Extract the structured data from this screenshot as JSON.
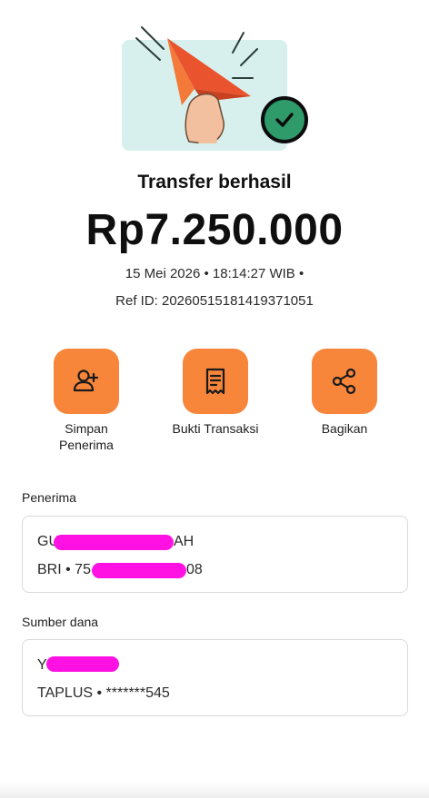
{
  "header": {
    "title": "Transfer berhasil",
    "amount": "Rp7.250.000",
    "datetime": "15 Mei 2026 • 18:14:27 WIB •",
    "ref_id": "Ref ID: 20260515181419371051"
  },
  "actions": [
    {
      "label": "Simpan Penerima",
      "icon": "add-user-icon"
    },
    {
      "label": "Bukti Transaksi",
      "icon": "receipt-icon"
    },
    {
      "label": "Bagikan",
      "icon": "share-icon"
    }
  ],
  "recipient": {
    "label": "Penerima",
    "name_prefix": "GU",
    "name_suffix": "AH",
    "account_prefix": "BRI • 75",
    "account_suffix": "08"
  },
  "source": {
    "label": "Sumber dana",
    "name_prefix": "Y",
    "account": "TAPLUS • *******545"
  },
  "colors": {
    "accent": "#f7863b",
    "success": "#2f9b6b",
    "hero_bg": "#d7f0ed",
    "redaction": "#ff11e3"
  }
}
